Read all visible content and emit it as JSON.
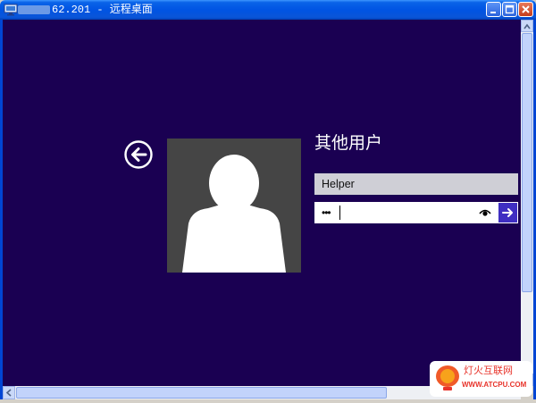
{
  "window": {
    "title": "62.201 - 远程桌面",
    "controls": {
      "minimize": "minimize-icon",
      "maximize": "maximize-icon",
      "close": "close-icon"
    }
  },
  "lockscreen": {
    "heading": "其他用户",
    "back_icon": "back-arrow-icon",
    "avatar_icon": "user-silhouette-icon",
    "username_value": "Helper",
    "password_mask": "•••",
    "reveal_icon": "eye-icon",
    "submit_icon": "arrow-right-icon"
  },
  "watermark": {
    "title": "灯火互联网",
    "subtitle": "WWW.ATCPU.COM"
  },
  "colors": {
    "background": "#1a0052",
    "submit": "#3f2ec2",
    "titlebar": "#0054e3"
  }
}
